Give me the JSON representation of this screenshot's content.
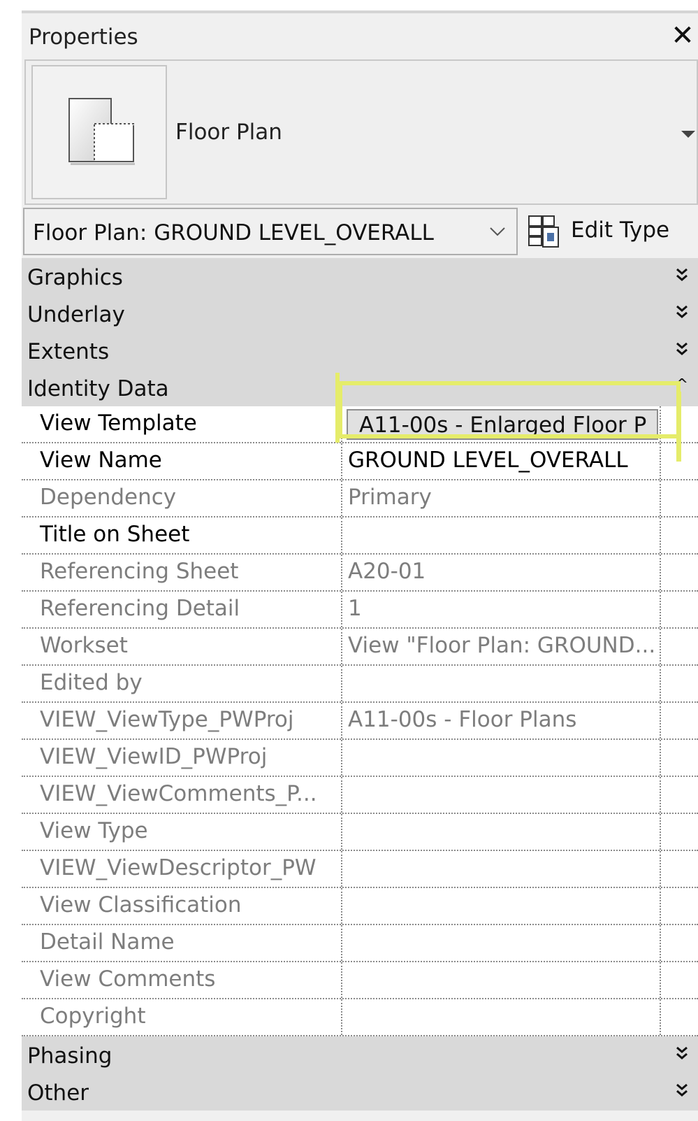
{
  "panel": {
    "title": "Properties",
    "close_glyph": "✕"
  },
  "type_selector": {
    "icon": "floor-plan-icon",
    "name": "Floor Plan",
    "dropdown_icon": "triangle-down-icon"
  },
  "instance_filter": {
    "value": "Floor Plan: GROUND LEVEL_OVERALL",
    "chevron_icon": "chevron-down-icon"
  },
  "edit_type": {
    "label": "Edit Type",
    "icon": "edit-type-icon"
  },
  "groups_before": [
    {
      "label": "Graphics",
      "toggle": "❯❯",
      "state": "collapsed"
    },
    {
      "label": "Underlay",
      "toggle": "❯❯",
      "state": "collapsed"
    },
    {
      "label": "Extents",
      "toggle": "❯❯",
      "state": "collapsed"
    }
  ],
  "identity_group": {
    "label": "Identity Data",
    "toggle": "^",
    "state": "expanded"
  },
  "identity_rows": [
    {
      "name": "View Template",
      "value": "A11-00s - Enlarged Floor P",
      "editable": true
    },
    {
      "name": "View Name",
      "value": "GROUND LEVEL_OVERALL",
      "editable": true
    },
    {
      "name": "Dependency",
      "value": "Primary",
      "editable": false
    },
    {
      "name": "Title on Sheet",
      "value": "",
      "editable": true
    },
    {
      "name": "Referencing Sheet",
      "value": "A20-01",
      "editable": false
    },
    {
      "name": "Referencing Detail",
      "value": "1",
      "editable": false
    },
    {
      "name": "Workset",
      "value": "View \"Floor Plan: GROUND...",
      "editable": false
    },
    {
      "name": "Edited by",
      "value": "",
      "editable": false
    },
    {
      "name": "VIEW_ViewType_PWProj",
      "value": "A11-00s - Floor Plans",
      "editable": false
    },
    {
      "name": "VIEW_ViewID_PWProj",
      "value": "",
      "editable": false
    },
    {
      "name": "VIEW_ViewComments_P...",
      "value": "",
      "editable": false
    },
    {
      "name": "View Type",
      "value": "",
      "editable": false
    },
    {
      "name": "VIEW_ViewDescriptor_PW",
      "value": "",
      "editable": false
    },
    {
      "name": "View Classification",
      "value": "",
      "editable": false
    },
    {
      "name": "Detail Name",
      "value": "",
      "editable": false
    },
    {
      "name": "View Comments",
      "value": "",
      "editable": false
    },
    {
      "name": "Copyright",
      "value": "",
      "editable": false
    }
  ],
  "groups_after": [
    {
      "label": "Phasing",
      "toggle": "❯❯",
      "state": "collapsed"
    },
    {
      "label": "Other",
      "toggle": "❯❯",
      "state": "collapsed"
    }
  ],
  "colors": {
    "highlight": "#e5ec6a",
    "group_header": "#d9d9d9",
    "readonly_text": "#7d7d7d"
  }
}
